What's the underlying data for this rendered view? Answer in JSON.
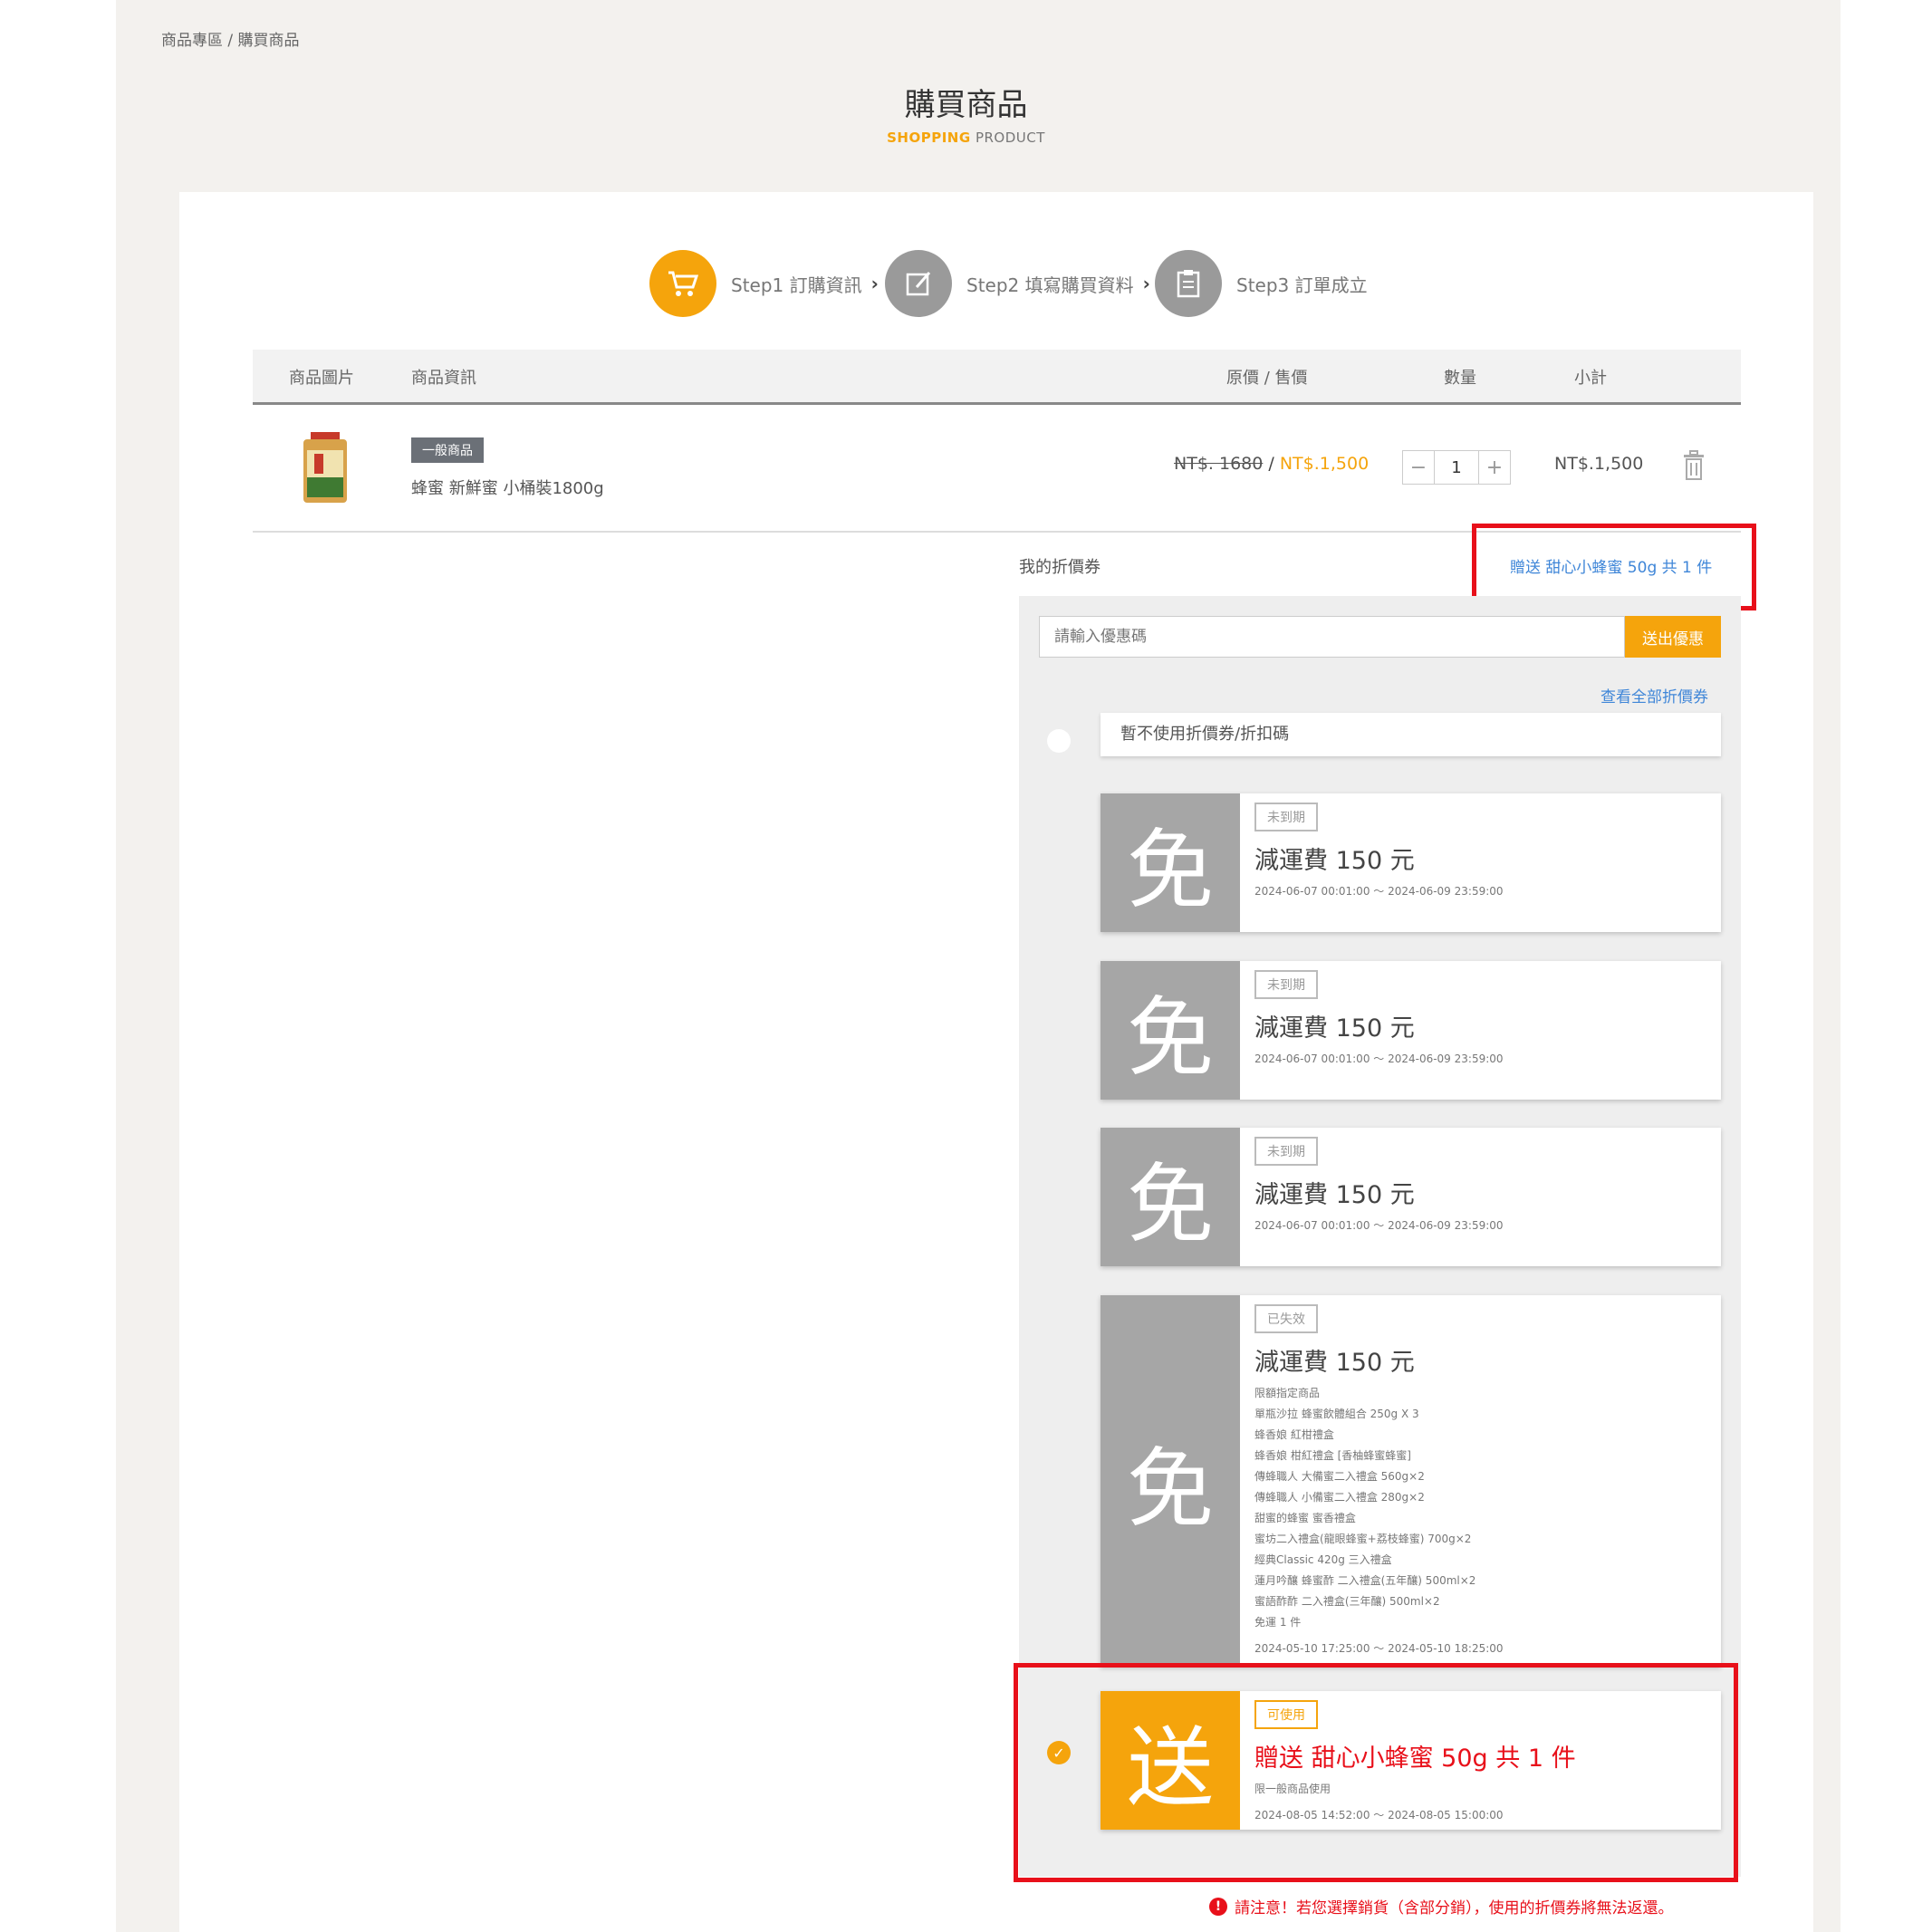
{
  "breadcrumb": "商品專區 / 購買商品",
  "header": {
    "title": "購買商品",
    "subtitle_a": "SHOPPING",
    "subtitle_b": "PRODUCT"
  },
  "steps": [
    {
      "label": "Step1 訂購資訊",
      "icon": "cart-icon",
      "active": true
    },
    {
      "label": "Step2 填寫購買資料",
      "icon": "edit-icon",
      "active": false
    },
    {
      "label": "Step3 訂單成立",
      "icon": "clipboard-icon",
      "active": false
    }
  ],
  "table": {
    "headers": [
      "商品圖片",
      "商品資訊",
      "原價 / 售價",
      "數量",
      "小計"
    ]
  },
  "product": {
    "badge": "一般商品",
    "name": "蜂蜜 新鮮蜜 小桶裝1800g",
    "original_price": "NT$. 1680",
    "separator": " / ",
    "sale_price": "NT$.1,500",
    "quantity": "1",
    "subtotal": "NT$.1,500"
  },
  "coupons": {
    "label": "我的折價券",
    "selected_text": "贈送 甜心小蜂蜜 50g 共 1 件",
    "code_placeholder": "請輸入優惠碼",
    "code_button": "送出優惠",
    "view_all": "查看全部折價券",
    "no_coupon": "暫不使用折價券/折扣碼",
    "items": [
      {
        "glyph": "免",
        "status": "未到期",
        "title": "減運費 150 元",
        "date": "2024-06-07 00:01:00 ～ 2024-06-09 23:59:00"
      },
      {
        "glyph": "免",
        "status": "未到期",
        "title": "減運費 150 元",
        "date": "2024-06-07 00:01:00 ～ 2024-06-09 23:59:00"
      },
      {
        "glyph": "免",
        "status": "未到期",
        "title": "減運費 150 元",
        "date": "2024-06-07 00:01:00 ～ 2024-06-09 23:59:00"
      },
      {
        "glyph": "免",
        "status": "已失效",
        "title": "減運費 150 元",
        "notes": [
          "限額指定商品",
          "單瓶沙拉 蜂蜜飲體組合 250g X 3",
          "蜂香娘 紅柑禮盒",
          "蜂香娘 柑紅禮盒 [香柚蜂蜜蜂蜜]",
          "傳蜂職人 大備蜜二入禮盒 560g×2",
          "傳蜂職人 小備蜜二入禮盒 280g×2",
          "甜蜜的蜂蜜 蜜香禮盒",
          "蜜坊二入禮盒(龍眼蜂蜜+荔枝蜂蜜) 700g×2",
          "經典Classic 420g 三入禮盒",
          "蓮月吟釀 蜂蜜酢 二入禮盒(五年釀) 500ml×2",
          "蜜語酢酢 二入禮盒(三年釀) 500ml×2",
          "免運 1 件"
        ],
        "date": "2024-05-10 17:25:00 ～ 2024-05-10 18:25:00"
      },
      {
        "glyph": "送",
        "status": "可使用",
        "title": "贈送 甜心小蜂蜜 50g 共 1 件",
        "notes": [
          "限一般商品使用"
        ],
        "date": "2024-08-05 14:52:00 ～ 2024-08-05 15:00:00"
      }
    ]
  },
  "warning": "請注意！若您選擇銷貨（含部分銷），使用的折價券將無法返還。",
  "colors": {
    "accent": "#f5a40c",
    "highlight": "#e8101a",
    "link": "#3f86d8"
  }
}
